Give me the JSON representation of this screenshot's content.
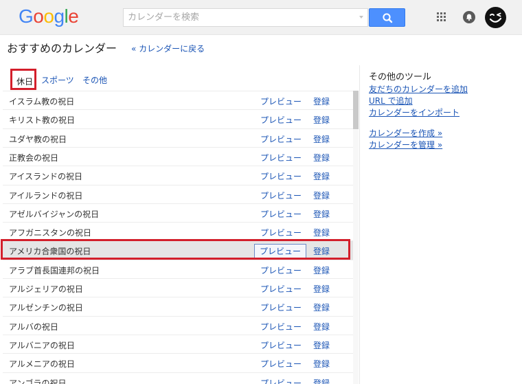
{
  "header": {
    "logo_letters": [
      {
        "ch": "G",
        "color": "#4285f4"
      },
      {
        "ch": "o",
        "color": "#ea4335"
      },
      {
        "ch": "o",
        "color": "#fbbc05"
      },
      {
        "ch": "g",
        "color": "#4285f4"
      },
      {
        "ch": "l",
        "color": "#34a853"
      },
      {
        "ch": "e",
        "color": "#ea4335"
      }
    ],
    "search_placeholder": "カレンダーを検索"
  },
  "page": {
    "title": "おすすめのカレンダー",
    "back_link": "« カレンダーに戻る"
  },
  "tabs": [
    "休日",
    "スポーツ",
    "その他"
  ],
  "calendars": [
    "イスラム教の祝日",
    "キリスト教の祝日",
    "ユダヤ教の祝日",
    "正教会の祝日",
    "アイスランドの祝日",
    "アイルランドの祝日",
    "アゼルバイジャンの祝日",
    "アフガニスタンの祝日",
    "アメリカ合衆国の祝日",
    "アラブ首長国連邦の祝日",
    "アルジェリアの祝日",
    "アルゼンチンの祝日",
    "アルバの祝日",
    "アルバニアの祝日",
    "アルメニアの祝日",
    "アンゴラの祝日"
  ],
  "row_actions": {
    "preview": "プレビュー",
    "register": "登録"
  },
  "highlighted_row": 8,
  "side": {
    "title": "その他のツール",
    "links": [
      "友だちのカレンダーを追加",
      "URL で追加",
      "カレンダーをインポート",
      "カレンダーを作成 »",
      "カレンダーを管理 »"
    ]
  },
  "colors": {
    "search_button": "#4d90fe",
    "link": "#1a54b5",
    "highlight_frame": "#d31f2b"
  },
  "icons": [
    "search-icon",
    "apps-grid-icon",
    "notification-bell-icon",
    "profile-avatar"
  ]
}
